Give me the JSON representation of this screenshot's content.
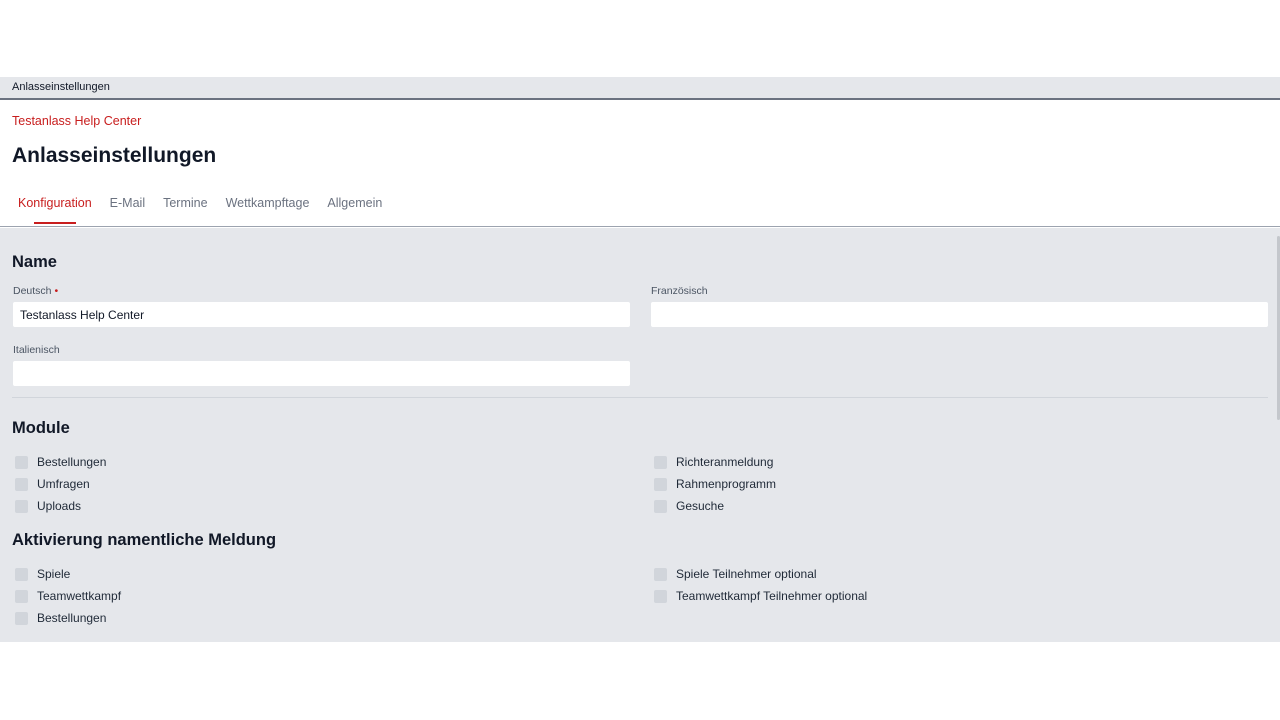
{
  "topbar": {
    "title": "Anlasseinstellungen"
  },
  "header": {
    "breadcrumb": "Testanlass Help Center",
    "title": "Anlasseinstellungen",
    "tabs": [
      {
        "label": "Konfiguration",
        "active": true
      },
      {
        "label": "E-Mail",
        "active": false
      },
      {
        "label": "Termine",
        "active": false
      },
      {
        "label": "Wettkampftage",
        "active": false
      },
      {
        "label": "Allgemein",
        "active": false
      }
    ]
  },
  "name_section": {
    "title": "Name",
    "deutsch": {
      "label": "Deutsch",
      "required_mark": "•",
      "value": "Testanlass Help Center"
    },
    "franzoesisch": {
      "label": "Französisch",
      "value": ""
    },
    "italienisch": {
      "label": "Italienisch",
      "value": ""
    }
  },
  "module_section": {
    "title": "Module",
    "left": [
      {
        "label": "Bestellungen",
        "checked": false
      },
      {
        "label": "Umfragen",
        "checked": false
      },
      {
        "label": "Uploads",
        "checked": false
      }
    ],
    "right": [
      {
        "label": "Richteranmeldung",
        "checked": false
      },
      {
        "label": "Rahmenprogramm",
        "checked": false
      },
      {
        "label": "Gesuche",
        "checked": false
      }
    ]
  },
  "aktivierung_section": {
    "title": "Aktivierung namentliche Meldung",
    "left": [
      {
        "label": "Spiele",
        "checked": false
      },
      {
        "label": "Teamwettkampf",
        "checked": false
      },
      {
        "label": "Bestellungen",
        "checked": false
      }
    ],
    "right": [
      {
        "label": "Spiele Teilnehmer optional",
        "checked": false
      },
      {
        "label": "Teamwettkampf Teilnehmer optional",
        "checked": false
      }
    ]
  },
  "colors": {
    "accent": "#c81e1e",
    "panel_bg": "#e5e7eb",
    "checkbox": "#d1d5db"
  }
}
